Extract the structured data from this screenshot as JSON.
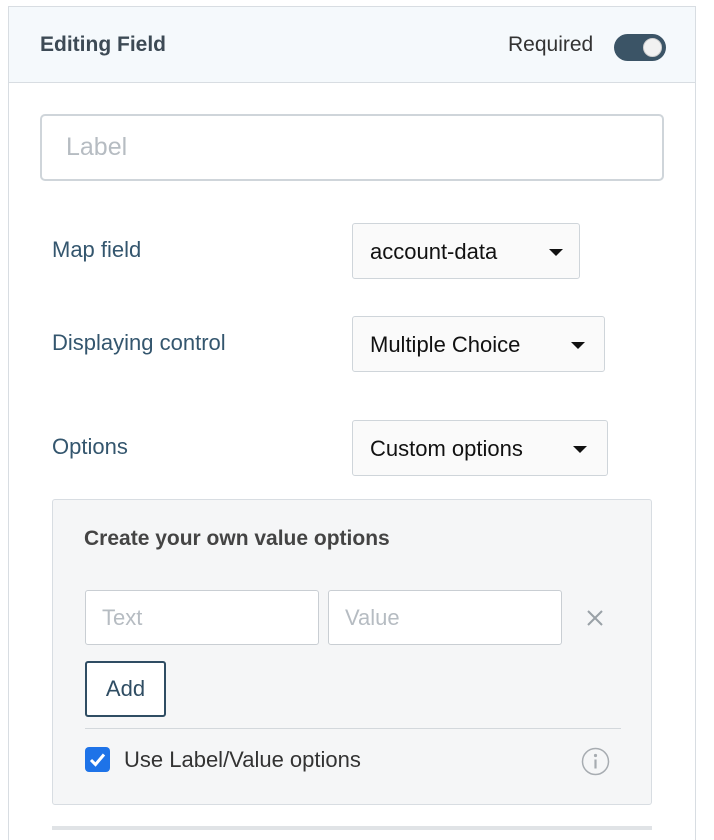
{
  "header": {
    "title": "Editing Field",
    "required_label": "Required",
    "required_on": true
  },
  "label_input": {
    "value": "",
    "placeholder": "Label"
  },
  "map_field": {
    "label": "Map field",
    "selected": "account-data"
  },
  "displaying_control": {
    "label": "Displaying control",
    "selected": "Multiple Choice"
  },
  "options": {
    "label": "Options",
    "selected": "Custom options"
  },
  "value_options": {
    "title": "Create your own value options",
    "text_placeholder": "Text",
    "value_placeholder": "Value",
    "add_label": "Add",
    "use_label_value_text": "Use Label/Value options",
    "use_label_value_checked": true
  },
  "icons": {
    "remove": "close-icon",
    "info": "info-icon",
    "dropdown": "caret-down-icon"
  },
  "colors": {
    "accent": "#3b5466",
    "checkbox": "#1e73e8",
    "label_text": "#34566e"
  }
}
